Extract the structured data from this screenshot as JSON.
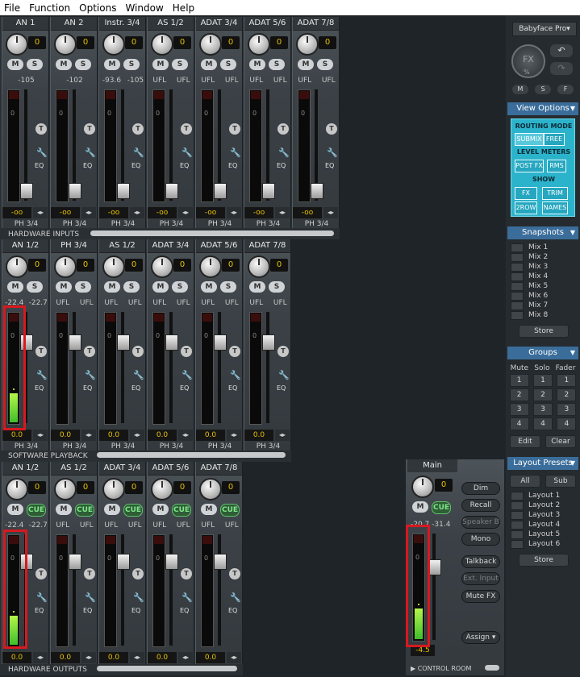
{
  "menu": [
    "File",
    "Function",
    "Options",
    "Window",
    "Help"
  ],
  "rows": [
    {
      "label": "HARDWARE INPUTS",
      "channels": [
        {
          "name": "AN 1",
          "gain": "0",
          "m": "M",
          "s": "S",
          "peak": [
            "-105"
          ],
          "vol": "-oo",
          "ph": "PH 3/4"
        },
        {
          "name": "AN 2",
          "gain": "0",
          "m": "M",
          "s": "S",
          "peak": [
            "-102"
          ],
          "vol": "-oo",
          "ph": "PH 3/4"
        },
        {
          "name": "Instr. 3/4",
          "gain": "0",
          "m": "M",
          "s": "S",
          "peak": [
            "-93.6",
            "-105"
          ],
          "vol": "-oo",
          "ph": "PH 3/4"
        },
        {
          "name": "AS 1/2",
          "gain": "0",
          "m": "M",
          "s": "S",
          "peak": [
            "UFL",
            "UFL"
          ],
          "vol": "-oo",
          "ph": "PH 3/4"
        },
        {
          "name": "ADAT 3/4",
          "gain": "0",
          "m": "M",
          "s": "S",
          "peak": [
            "UFL",
            "UFL"
          ],
          "vol": "-oo",
          "ph": "PH 3/4"
        },
        {
          "name": "ADAT 5/6",
          "gain": "0",
          "m": "M",
          "s": "S",
          "peak": [
            "UFL",
            "UFL"
          ],
          "vol": "-oo",
          "ph": "PH 3/4"
        },
        {
          "name": "ADAT 7/8",
          "gain": "0",
          "m": "M",
          "s": "S",
          "peak": [
            "UFL",
            "UFL"
          ],
          "vol": "-oo",
          "ph": "PH 3/4"
        }
      ]
    },
    {
      "label": "SOFTWARE PLAYBACK",
      "channels": [
        {
          "name": "AN 1/2",
          "gain": "0",
          "m": "M",
          "s": "S",
          "peak": [
            "-22.4",
            "-22.7"
          ],
          "vol": "0.0",
          "ph": "PH 3/4"
        },
        {
          "name": "PH 3/4",
          "gain": "0",
          "m": "M",
          "s": "S",
          "peak": [
            "UFL",
            "UFL"
          ],
          "vol": "0.0",
          "ph": "PH 3/4"
        },
        {
          "name": "AS 1/2",
          "gain": "0",
          "m": "M",
          "s": "S",
          "peak": [
            "UFL",
            "UFL"
          ],
          "vol": "0.0",
          "ph": "PH 3/4"
        },
        {
          "name": "ADAT 3/4",
          "gain": "0",
          "m": "M",
          "s": "S",
          "peak": [
            "UFL",
            "UFL"
          ],
          "vol": "0.0",
          "ph": "PH 3/4"
        },
        {
          "name": "ADAT 5/6",
          "gain": "0",
          "m": "M",
          "s": "S",
          "peak": [
            "UFL",
            "UFL"
          ],
          "vol": "0.0",
          "ph": "PH 3/4"
        },
        {
          "name": "ADAT 7/8",
          "gain": "0",
          "m": "M",
          "s": "S",
          "peak": [
            "UFL",
            "UFL"
          ],
          "vol": "0.0",
          "ph": "PH 3/4"
        }
      ]
    },
    {
      "label": "HARDWARE OUTPUTS",
      "channels": [
        {
          "name": "AN 1/2",
          "gain": "0",
          "m": "M",
          "s": "CUE",
          "peak": [
            "-22.4",
            "-22.7"
          ],
          "vol": "0.0",
          "ph": "EQ"
        },
        {
          "name": "AS 1/2",
          "gain": "0",
          "m": "M",
          "s": "CUE",
          "peak": [
            "UFL",
            "UFL"
          ],
          "vol": "0.0",
          "ph": "EQ"
        },
        {
          "name": "ADAT 3/4",
          "gain": "0",
          "m": "M",
          "s": "CUE",
          "peak": [
            "UFL",
            "UFL"
          ],
          "vol": "0.0",
          "ph": "EQ"
        },
        {
          "name": "ADAT 5/6",
          "gain": "0",
          "m": "M",
          "s": "CUE",
          "peak": [
            "UFL",
            "UFL"
          ],
          "vol": "0.0",
          "ph": "EQ"
        },
        {
          "name": "ADAT 7/8",
          "gain": "0",
          "m": "M",
          "s": "CUE",
          "peak": [
            "UFL",
            "UFL"
          ],
          "vol": "0.0",
          "ph": "EQ"
        }
      ]
    }
  ],
  "control_room": {
    "label": "CONTROL ROOM",
    "main": {
      "name": "Main",
      "gain": "0",
      "m": "M",
      "s": "CUE",
      "peak": "-20.7 -31.4",
      "vol": "-4.5"
    },
    "buttons": [
      "Dim",
      "Recall",
      "Speaker B",
      "Mono",
      "Talkback",
      "Ext. Input",
      "Mute FX",
      "Assign"
    ]
  },
  "right_panel": {
    "device": "Babyface Pro",
    "fx": "FX",
    "fx_pct": "%",
    "msf": [
      "M",
      "S",
      "F"
    ],
    "view_options": "View Options",
    "routing_mode": "ROUTING MODE",
    "submix": "SUBMIX",
    "free": "FREE",
    "level_meters": "LEVEL METERS",
    "post_fx": "POST FX",
    "rms": "RMS",
    "show": "SHOW",
    "fx_btn": "FX",
    "trim": "TRIM",
    "two_row": "2ROW",
    "names": "NAMES",
    "snapshots": "Snapshots",
    "mixes": [
      "Mix 1",
      "Mix 2",
      "Mix 3",
      "Mix 4",
      "Mix 5",
      "Mix 6",
      "Mix 7",
      "Mix 8"
    ],
    "store": "Store",
    "groups": "Groups",
    "group_headers": [
      "Mute",
      "Solo",
      "Fader"
    ],
    "group_rows": [
      [
        "1",
        "1",
        "1"
      ],
      [
        "2",
        "2",
        "2"
      ],
      [
        "3",
        "3",
        "3"
      ],
      [
        "4",
        "4",
        "4"
      ]
    ],
    "edit": "Edit",
    "clear": "Clear",
    "layout_presets": "Layout Presets",
    "all": "All",
    "sub": "Sub",
    "layouts": [
      "Layout 1",
      "Layout 2",
      "Layout 3",
      "Layout 4",
      "Layout 5",
      "Layout 6"
    ],
    "store2": "Store"
  }
}
